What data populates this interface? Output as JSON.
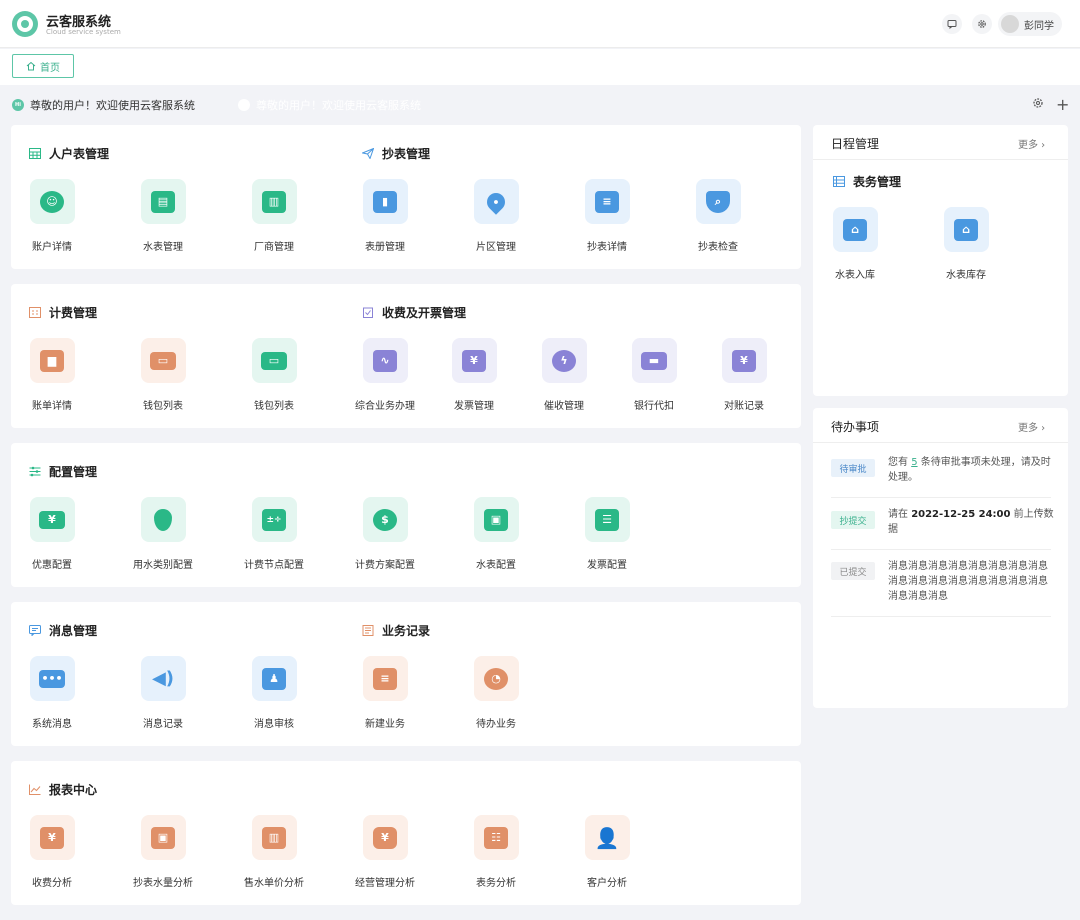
{
  "app": {
    "title": "云客服系统",
    "subtitle": "Cloud service system"
  },
  "header_icons": {
    "message": "message-icon",
    "settings": "gear-icon"
  },
  "user": {
    "name": "彭同学"
  },
  "tabs": [
    {
      "label": "首页"
    }
  ],
  "welcome": {
    "text": "尊敬的用户！欢迎使用云客服系统",
    "ghost_text": "尊敬的用户！欢迎使用云客服系统"
  },
  "sections": {
    "household": {
      "title": "人户表管理",
      "items": [
        {
          "label": "账户详情"
        },
        {
          "label": "水表管理"
        },
        {
          "label": "厂商管理"
        }
      ]
    },
    "reading": {
      "title": "抄表管理",
      "items": [
        {
          "label": "表册管理"
        },
        {
          "label": "片区管理"
        },
        {
          "label": "抄表详情"
        },
        {
          "label": "抄表检查"
        }
      ]
    },
    "billing": {
      "title": "计费管理",
      "items": [
        {
          "label": "账单详情"
        },
        {
          "label": "钱包列表"
        },
        {
          "label": "钱包列表"
        }
      ]
    },
    "charge": {
      "title": "收费及开票管理",
      "items": [
        {
          "label": "综合业务办理"
        },
        {
          "label": "发票管理"
        },
        {
          "label": "催收管理"
        },
        {
          "label": "银行代扣"
        },
        {
          "label": "对账记录"
        }
      ]
    },
    "config": {
      "title": "配置管理",
      "items": [
        {
          "label": "优惠配置"
        },
        {
          "label": "用水类别配置"
        },
        {
          "label": "计费节点配置"
        },
        {
          "label": "计费方案配置"
        },
        {
          "label": "水表配置"
        },
        {
          "label": "发票配置"
        }
      ]
    },
    "message": {
      "title": "消息管理",
      "items": [
        {
          "label": "系统消息"
        },
        {
          "label": "消息记录"
        },
        {
          "label": "消息审核"
        }
      ]
    },
    "business": {
      "title": "业务记录",
      "items": [
        {
          "label": "新建业务"
        },
        {
          "label": "待办业务"
        }
      ]
    },
    "report": {
      "title": "报表中心",
      "items": [
        {
          "label": "收费分析"
        },
        {
          "label": "抄表水量分析"
        },
        {
          "label": "售水单价分析"
        },
        {
          "label": "经营管理分析"
        },
        {
          "label": "表务分析"
        },
        {
          "label": "客户分析"
        }
      ]
    }
  },
  "schedule": {
    "title": "日程管理",
    "more": "更多",
    "subtitle": "表务管理",
    "items": [
      {
        "label": "水表入库"
      },
      {
        "label": "水表库存"
      }
    ]
  },
  "todo": {
    "title": "待办事项",
    "more": "更多",
    "items": [
      {
        "tag": "待审批",
        "text_before": "您有",
        "count": "5",
        "text_after": "条待审批事项未处理，请及时处理。"
      },
      {
        "tag": "抄提交",
        "text_before": "请在",
        "date": "2022-12-25 24:00",
        "text_after": "前上传数据"
      },
      {
        "tag": "已提交",
        "text": "消息消息消息消息消息消息消息消息消息消息消息消息消息消息消息消息消息消息消息"
      }
    ]
  },
  "colors": {
    "accent": "#5dc6a7",
    "teal": "#2ab887",
    "blue": "#4a98e0",
    "orange": "#e09068",
    "purple": "#8a83d6"
  }
}
